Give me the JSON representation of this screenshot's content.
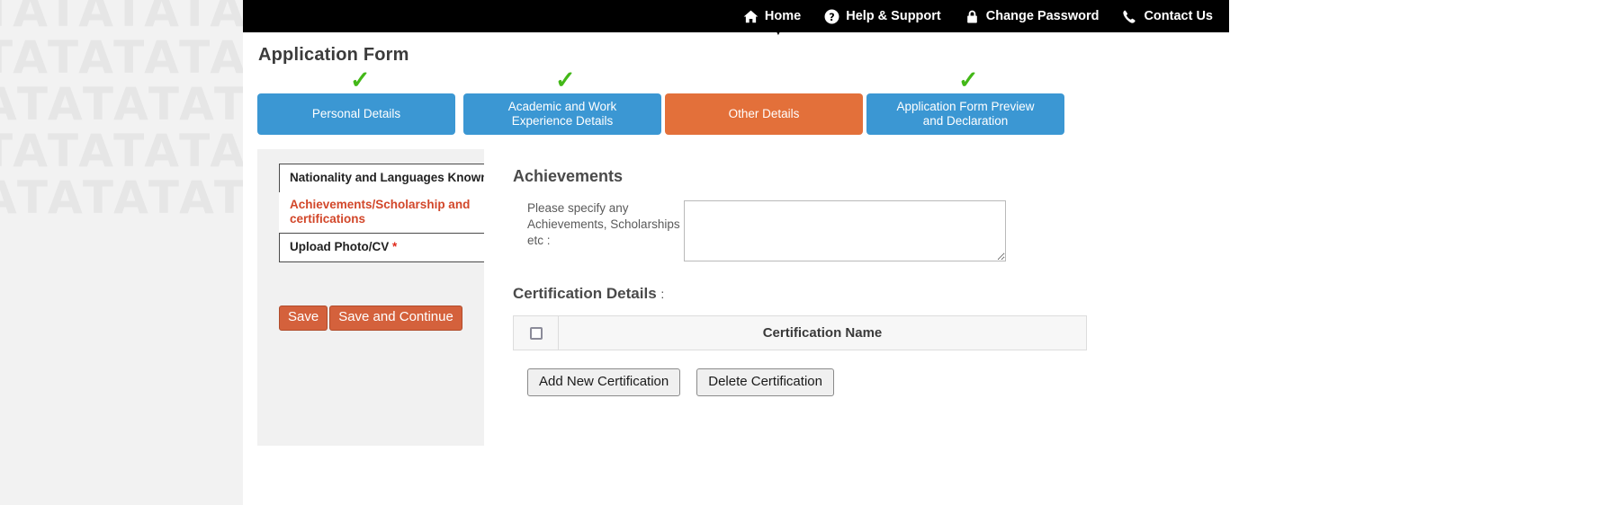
{
  "navbar": {
    "items": [
      {
        "label": "Home",
        "icon": "home-icon"
      },
      {
        "label": "Help & Support",
        "icon": "question-circle-icon"
      },
      {
        "label": "Change Password",
        "icon": "lock-icon"
      },
      {
        "label": "Contact Us",
        "icon": "phone-icon"
      }
    ],
    "caret": "▼",
    "background": "#000000"
  },
  "page": {
    "title": "Application Form"
  },
  "steps": {
    "check_mark": "✓",
    "items": [
      {
        "label": "Personal Details",
        "state": "blue",
        "completed": true
      },
      {
        "label": "Academic and Work\nExperience Details",
        "state": "blue",
        "completed": true
      },
      {
        "label": "Other Details",
        "state": "orange",
        "completed": false
      },
      {
        "label": "Application Form Preview\nand Declaration",
        "state": "blue",
        "completed": true
      }
    ],
    "colors": {
      "blue": "#3b97d3",
      "orange": "#e3703a",
      "check": "#43b818"
    }
  },
  "sidebar": {
    "items": [
      {
        "label": "Nationality and Languages Known",
        "required": true,
        "active": false
      },
      {
        "label": "Achievements/Scholarship and certifications",
        "required": false,
        "active": true
      },
      {
        "label": "Upload Photo/CV",
        "required": true,
        "active": false
      }
    ],
    "required_marker": "*",
    "buttons": [
      {
        "label": "Save"
      },
      {
        "label": "Save and Continue"
      }
    ]
  },
  "main": {
    "section_title": "Achievements",
    "achievements_field": {
      "label": "Please specify any Achievements, Scholarships etc :",
      "value": "",
      "placeholder": ""
    },
    "certification": {
      "title": "Certification Details",
      "colon": ":",
      "columns": [
        "",
        "Certification Name"
      ],
      "rows": [],
      "buttons": [
        {
          "label": "Add New Certification"
        },
        {
          "label": "Delete Certification"
        }
      ]
    }
  },
  "watermark": {
    "text": "TATATATA\nTATATATA\nATATATAT\nTATATATA\nATATATAT"
  }
}
